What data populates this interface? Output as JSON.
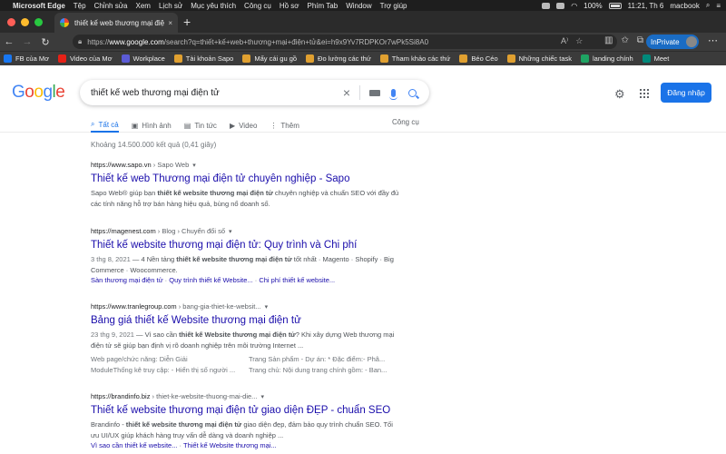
{
  "menubar": {
    "app": "Microsoft Edge",
    "items": [
      "Tệp",
      "Chỉnh sửa",
      "Xem",
      "Lịch sử",
      "Mục yêu thích",
      "Công cụ",
      "Hồ sơ",
      "Phím Tab",
      "Window",
      "Trợ giúp"
    ],
    "battery": "100%",
    "clock": "11:21, Th 6",
    "user": "macbook"
  },
  "tab": {
    "title": "thiết kế web thương mại điện tử",
    "close": "×",
    "new": "+"
  },
  "address": {
    "prefix": "https://",
    "host": "www.google.com",
    "path": "/search?q=thiết+kế+web+thương+mại+điện+tử&ei=h9x9Yv7RDPKOr7wPk5Si8A0",
    "inprivate": "InPrivate"
  },
  "favorites": [
    {
      "label": "FB của Mơ",
      "color": "#1877f2"
    },
    {
      "label": "Video của Mơ",
      "color": "#e62117"
    },
    {
      "label": "Workplace",
      "color": "#5b5bd6"
    },
    {
      "label": "Tài khoản Sapo",
      "color": "#e0a030"
    },
    {
      "label": "Mấy cái gu gồ",
      "color": "#e0a030"
    },
    {
      "label": "Đo lường các thứ",
      "color": "#e0a030"
    },
    {
      "label": "Tham khảo các thứ",
      "color": "#e0a030"
    },
    {
      "label": "Béo Céo",
      "color": "#e0a030"
    },
    {
      "label": "Những chiếc task",
      "color": "#e0a030"
    },
    {
      "label": "landing chính",
      "color": "#1fa463"
    },
    {
      "label": "Meet",
      "color": "#00897b"
    }
  ],
  "google": {
    "logo": [
      "G",
      "o",
      "o",
      "g",
      "l",
      "e"
    ],
    "logo_colors": [
      "#4285f4",
      "#ea4335",
      "#fbbc05",
      "#4285f4",
      "#34a853",
      "#ea4335"
    ],
    "query": "thiết kế web thương mại điện tử",
    "signin": "Đăng nhập",
    "tabs": [
      {
        "icon": "⌕",
        "label": "Tất cả",
        "active": true
      },
      {
        "icon": "▣",
        "label": "Hình ảnh"
      },
      {
        "icon": "▤",
        "label": "Tin tức"
      },
      {
        "icon": "▶",
        "label": "Video"
      },
      {
        "icon": "⋮",
        "label": "Thêm"
      }
    ],
    "tools": "Công cụ",
    "stats": "Khoảng 14.500.000 kết quả (0,41 giây)"
  },
  "results": [
    {
      "url": "https://www.sapo.vn",
      "crumb": " › Sapo Web",
      "title": "Thiết kế web Thương mại điện tử chuyên nghiệp - Sapo",
      "snippet": [
        {
          "t": "Sapo Web® giúp bạn "
        },
        {
          "t": "thiết kế website thương mại điện tử",
          "b": true
        },
        {
          "t": " chuyên nghiệp và chuẩn SEO với đầy đủ các tính năng hỗ trợ bán hàng hiệu quả, bùng nổ doanh số."
        }
      ]
    },
    {
      "url": "https://magenest.com",
      "crumb": " › Blog › Chuyển đổi số",
      "title": "Thiết kế website thương mại điện tử: Quy trình và Chi phí",
      "date": "3 thg 8, 2021",
      "snippet": [
        {
          "t": " — 4 Nền tảng "
        },
        {
          "t": "thiết kế website thương mại điện tử",
          "b": true
        },
        {
          "t": " tốt nhất · Magento · Shopify · Big Commerce · Woocommerce."
        }
      ],
      "links": [
        "Sàn thương mại điện tử",
        "Quy trình thiết kế Website...",
        "Chi phí thiết kế website..."
      ]
    },
    {
      "url": "https://www.tranlegroup.com",
      "crumb": " › bang-gia-thiet-ke-websit...",
      "title": "Bảng giá thiết kế Website thương mại điện tử",
      "date": "23 thg 9, 2021",
      "snippet": [
        {
          "t": " — Vì sao cần "
        },
        {
          "t": "thiết kế Website thương mại điện tử",
          "b": true
        },
        {
          "t": "? Khi xây dựng Web thương mại điện tử sẽ giúp bạn định vị rõ doanh nghiệp trên môi trường Internet ..."
        }
      ],
      "table": [
        "Web page/chức năng: Diễn Giải",
        "Trang Sản phẩm - Dự án: * Đặc điểm:- Phâ...",
        "ModuleThống kê truy cập: - Hiển thị số người ...",
        "Trang chủ: Nội dung trang chính gồm: - Ban..."
      ]
    },
    {
      "url": "https://brandinfo.biz",
      "crumb": " › thiet-ke-website-thuong-mai-die...",
      "title": "Thiết kế website thương mại điện tử giao diện ĐẸP - chuẩn SEO",
      "snippet": [
        {
          "t": "Brandinfo - "
        },
        {
          "t": "thiết kế website thương mại điện tử",
          "b": true
        },
        {
          "t": " giao diện đẹp, đảm bảo quy trình chuẩn SEO. Tối ưu UI/UX giúp khách hàng truy vấn dễ dàng và doanh nghiệp ..."
        }
      ],
      "links": [
        "Vì sao cần thiết kế website...",
        "Thiết kế Website thương mại..."
      ]
    }
  ]
}
